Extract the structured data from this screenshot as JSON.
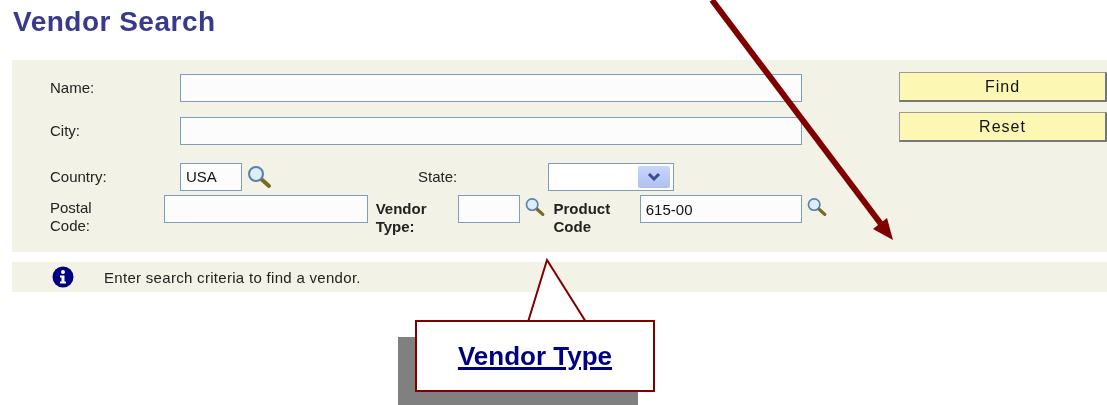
{
  "title": "Vendor Search",
  "fields": {
    "name": {
      "label": "Name:"
    },
    "city": {
      "label": "City:"
    },
    "country": {
      "label": "Country:",
      "value": "USA"
    },
    "state": {
      "label": "State:"
    },
    "postal_code": {
      "label": "Postal Code:"
    },
    "vendor_type": {
      "label": "Vendor Type:"
    },
    "product_code": {
      "label": "Product Code",
      "value": "615-00"
    }
  },
  "buttons": [
    "Find",
    "Reset"
  ],
  "message": "Enter search criteria to find a vendor.",
  "callout": {
    "text": "Vendor Type"
  }
}
